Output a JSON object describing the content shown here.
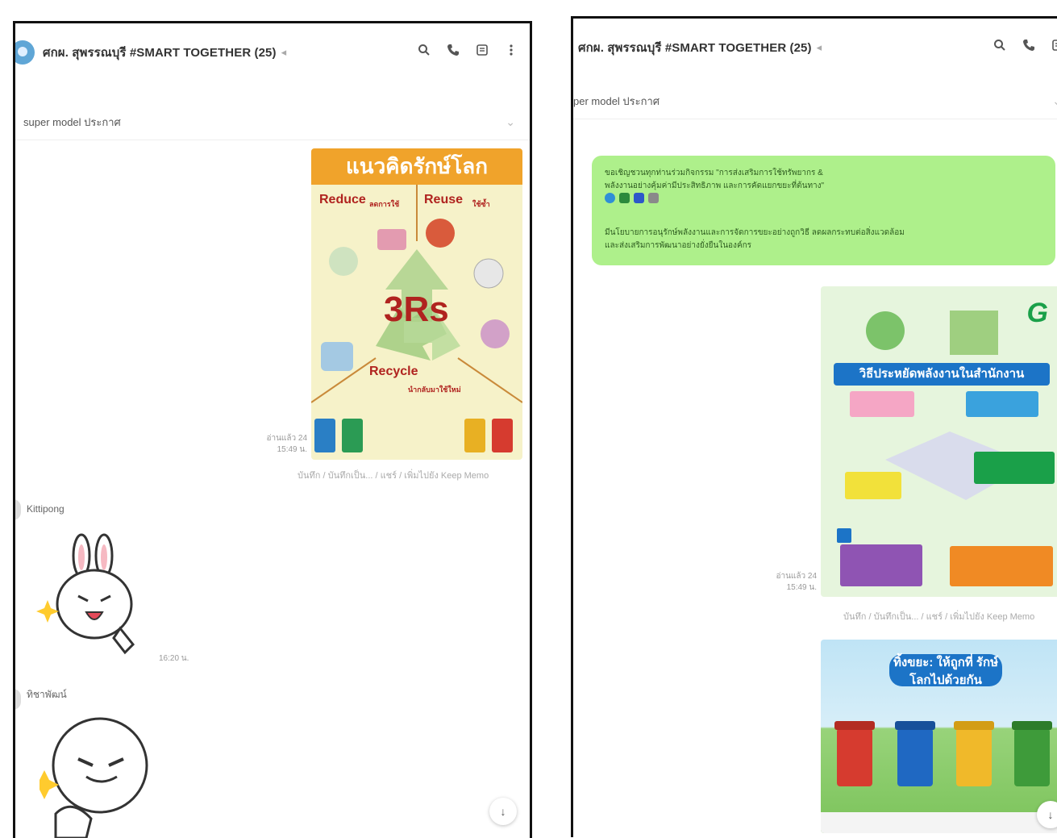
{
  "left": {
    "header": {
      "title": "ศกผ. สุพรรณบุรี #SMART TOGETHER (25)",
      "mute": "◂"
    },
    "notice": {
      "text": "super model ประกาศ"
    },
    "poster": {
      "title": "แนวคิดรักษ์โลก",
      "big": "3Rs",
      "reduce": "Reduce",
      "reduce_th": "ลดการใช้",
      "reuse": "Reuse",
      "reuse_th": "ใช้ซ้ำ",
      "recycle": "Recycle",
      "recycle_th": "นำกลับมาใช้ใหม่"
    },
    "poster_time": {
      "read": "อ่านแล้ว 24",
      "time": "15:49 น."
    },
    "poster_actions": "บันทึก / บันทึกเป็น... / แชร์ / เพิ่มไปยัง Keep Memo",
    "sender1": "Kittipong",
    "sticker1_time": "16:20 น.",
    "sender2": "ทิชาพัฒน์"
  },
  "right": {
    "header": {
      "title": "ศกผ. สุพรรณบุรี #SMART TOGETHER (25)",
      "mute": "◂"
    },
    "notice": {
      "text": "per model ประกาศ"
    },
    "message": {
      "line1": "ขอเชิญชวนทุกท่านร่วมกิจกรรม \"การส่งเสริมการใช้ทรัพยากร &",
      "line2": "พลังงานอย่างคุ้มค่ามีประสิทธิภาพ และการคัดแยกขยะที่ต้นทาง\"",
      "line3": "มีนโยบายการอนุรักษ์พลังงานและการจัดการขยะอย่างถูกวิธี ลดผลกระทบต่อสิ่งแวดล้อม",
      "line4": "และส่งเสริมการพัฒนาอย่างยั่งยืนในองค์กร"
    },
    "poster_energy": {
      "title": "วิธีประหยัดพลังงานในสำนักงาน",
      "logo": "G"
    },
    "poster_energy_time": {
      "read": "อ่านแล้ว 24",
      "time": "15:49 น."
    },
    "poster_energy_actions": "บันทึก / บันทึกเป็น... / แชร์ / เพิ่มไปยัง Keep Memo",
    "poster_bins": {
      "title": "ทิ้งขยะ: ให้ถูกที่ รักษ์โลกไปด้วยกัน"
    }
  },
  "icons": {
    "search": "search-icon",
    "call": "phone-icon",
    "notes": "notes-icon",
    "more": "more-icon",
    "chevron": "chevron-down-icon",
    "scroll": "arrow-down-icon"
  }
}
